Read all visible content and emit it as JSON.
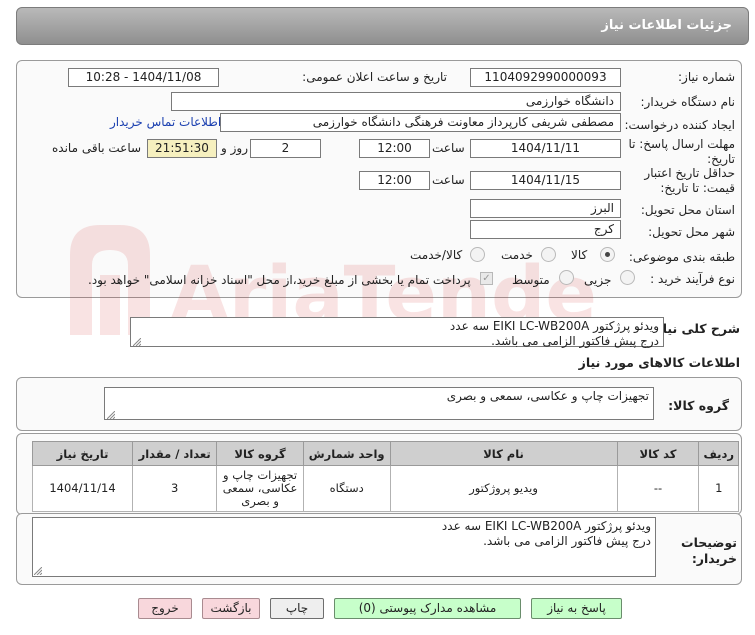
{
  "header": {
    "title": "جزئیات اطلاعات نیاز"
  },
  "form": {
    "need_number_label": "شماره نیاز:",
    "need_number": "1104092990000093",
    "announce_label": "تاریخ و ساعت اعلان عمومی:",
    "announce_value": "1404/11/08 - 10:28",
    "buyer_org_label": "نام دستگاه خریدار:",
    "buyer_org": "دانشگاه خوارزمی",
    "creator_label": "ایجاد کننده درخواست:",
    "creator": "مصطفی شریفی کارپرداز معاونت فرهنگی دانشگاه خوارزمی",
    "contact_link": "اطلاعات تماس خریدار",
    "deadline_label": "مهلت ارسال پاسخ: تا تاریخ:",
    "deadline_date": "1404/11/11",
    "time_label": "ساعت",
    "deadline_time": "12:00",
    "days_value": "2",
    "days_label": "روز و",
    "remaining_time": "21:51:30",
    "remaining_label": "ساعت باقی مانده",
    "validity_label": "حداقل تاریخ اعتبار قیمت: تا تاریخ:",
    "validity_date": "1404/11/15",
    "validity_time": "12:00",
    "province_label": "استان محل تحویل:",
    "province": "البرز",
    "city_label": "شهر محل تحویل:",
    "city": "کرج",
    "category_label": "طبقه بندی موضوعی:",
    "category_options": [
      "کالا",
      "خدمت",
      "کالا/خدمت"
    ],
    "process_label": "نوع فرآیند خرید :",
    "process_options": [
      "جزیی",
      "متوسط"
    ],
    "payment_note": "پرداخت تمام یا بخشی از مبلغ خرید،از محل \"اسناد خزانه اسلامی\" خواهد بود."
  },
  "summary": {
    "label": "شرح کلی نیاز:",
    "line1": "ویدئو پرژکتور EIKI LC-WB200A سه عدد",
    "line2": "درج پیش فاکتور الزامی می باشد."
  },
  "goods": {
    "section_title": "اطلاعات کالاهای مورد نیاز",
    "group_label": "گروه کالا:",
    "group_value": "تجهیزات چاپ و عکاسی، سمعی و بصری",
    "table": {
      "headers": [
        "ردیف",
        "کد کالا",
        "نام کالا",
        "واحد شمارش",
        "گروه کالا",
        "تعداد / مقدار",
        "تاریخ نیاز"
      ],
      "rows": [
        [
          "1",
          "--",
          "ویدیو پروژکتور",
          "دستگاه",
          "تجهیزات چاپ و عکاسی، سمعی و بصری",
          "3",
          "1404/11/14"
        ]
      ]
    }
  },
  "buyer_notes": {
    "label": "توضیحات خریدار:",
    "line1": "ویدئو پرژکتور EIKI LC-WB200A سه عدد",
    "line2": "درج پیش فاکتور الزامی می باشد."
  },
  "buttons": {
    "reply": "پاسخ به نیاز",
    "attachments": "مشاهده مدارک پیوستی (0)",
    "print": "چاپ",
    "back": "بازگشت",
    "exit": "خروج"
  },
  "watermark": {
    "text": "AriaTender.net"
  },
  "colors": {
    "title_bar": "#a4a4a4",
    "accent_green": "#c7ffca",
    "accent_pink": "#f8d7dc",
    "remaining_bg": "#f6f0bf",
    "link": "#1a3fb0"
  },
  "icons": [
    "radio-selected-icon",
    "radio-icon",
    "checkbox-icon",
    "resize-grip-icon",
    "watermark-logo-icon"
  ]
}
